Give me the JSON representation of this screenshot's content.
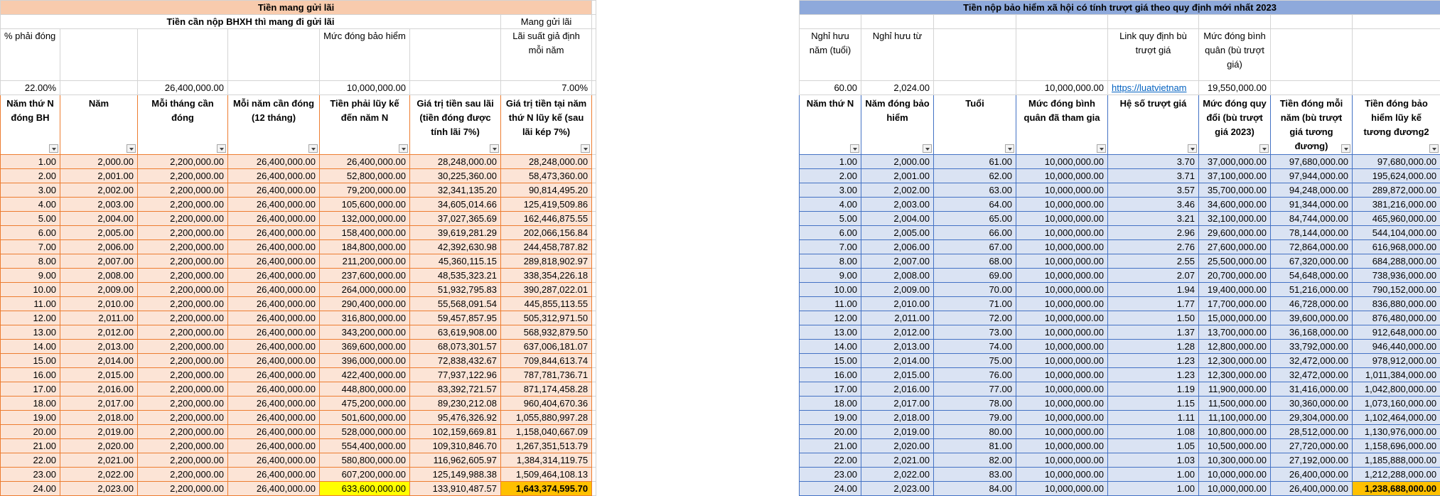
{
  "left": {
    "banner": "Tiền mang gửi lãi",
    "subtitle_left": "Tiền cần nộp BHXH thì mang đi gửi lãi",
    "subtitle_right": "Mang gửi lãi",
    "params_labels": {
      "a": "% phải đóng",
      "b": "",
      "c": "",
      "d": "",
      "e": "Mức đóng bảo hiểm",
      "f": "",
      "g": "Lãi suất giả định mỗi năm"
    },
    "params_values": {
      "a": "22.00%",
      "b": "",
      "c": "26,400,000.00",
      "d": "",
      "e": "10,000,000.00",
      "f": "",
      "g": "7.00%"
    },
    "headers": [
      "Năm thứ N đóng BH",
      "Năm",
      "Mỗi tháng cần đóng",
      "Mỗi năm cần đóng (12 tháng)",
      "Tiền phải lũy kế đến năm N",
      "Giá trị tiền sau lãi (tiền đóng được tính lãi 7%)",
      "Giá trị tiền tại năm thứ N lũy kế (sau lãi kép 7%)"
    ],
    "rows": [
      [
        "1.00",
        "2,000.00",
        "2,200,000.00",
        "26,400,000.00",
        "26,400,000.00",
        "28,248,000.00",
        "28,248,000.00"
      ],
      [
        "2.00",
        "2,001.00",
        "2,200,000.00",
        "26,400,000.00",
        "52,800,000.00",
        "30,225,360.00",
        "58,473,360.00"
      ],
      [
        "3.00",
        "2,002.00",
        "2,200,000.00",
        "26,400,000.00",
        "79,200,000.00",
        "32,341,135.20",
        "90,814,495.20"
      ],
      [
        "4.00",
        "2,003.00",
        "2,200,000.00",
        "26,400,000.00",
        "105,600,000.00",
        "34,605,014.66",
        "125,419,509.86"
      ],
      [
        "5.00",
        "2,004.00",
        "2,200,000.00",
        "26,400,000.00",
        "132,000,000.00",
        "37,027,365.69",
        "162,446,875.55"
      ],
      [
        "6.00",
        "2,005.00",
        "2,200,000.00",
        "26,400,000.00",
        "158,400,000.00",
        "39,619,281.29",
        "202,066,156.84"
      ],
      [
        "7.00",
        "2,006.00",
        "2,200,000.00",
        "26,400,000.00",
        "184,800,000.00",
        "42,392,630.98",
        "244,458,787.82"
      ],
      [
        "8.00",
        "2,007.00",
        "2,200,000.00",
        "26,400,000.00",
        "211,200,000.00",
        "45,360,115.15",
        "289,818,902.97"
      ],
      [
        "9.00",
        "2,008.00",
        "2,200,000.00",
        "26,400,000.00",
        "237,600,000.00",
        "48,535,323.21",
        "338,354,226.18"
      ],
      [
        "10.00",
        "2,009.00",
        "2,200,000.00",
        "26,400,000.00",
        "264,000,000.00",
        "51,932,795.83",
        "390,287,022.01"
      ],
      [
        "11.00",
        "2,010.00",
        "2,200,000.00",
        "26,400,000.00",
        "290,400,000.00",
        "55,568,091.54",
        "445,855,113.55"
      ],
      [
        "12.00",
        "2,011.00",
        "2,200,000.00",
        "26,400,000.00",
        "316,800,000.00",
        "59,457,857.95",
        "505,312,971.50"
      ],
      [
        "13.00",
        "2,012.00",
        "2,200,000.00",
        "26,400,000.00",
        "343,200,000.00",
        "63,619,908.00",
        "568,932,879.50"
      ],
      [
        "14.00",
        "2,013.00",
        "2,200,000.00",
        "26,400,000.00",
        "369,600,000.00",
        "68,073,301.57",
        "637,006,181.07"
      ],
      [
        "15.00",
        "2,014.00",
        "2,200,000.00",
        "26,400,000.00",
        "396,000,000.00",
        "72,838,432.67",
        "709,844,613.74"
      ],
      [
        "16.00",
        "2,015.00",
        "2,200,000.00",
        "26,400,000.00",
        "422,400,000.00",
        "77,937,122.96",
        "787,781,736.71"
      ],
      [
        "17.00",
        "2,016.00",
        "2,200,000.00",
        "26,400,000.00",
        "448,800,000.00",
        "83,392,721.57",
        "871,174,458.28"
      ],
      [
        "18.00",
        "2,017.00",
        "2,200,000.00",
        "26,400,000.00",
        "475,200,000.00",
        "89,230,212.08",
        "960,404,670.36"
      ],
      [
        "19.00",
        "2,018.00",
        "2,200,000.00",
        "26,400,000.00",
        "501,600,000.00",
        "95,476,326.92",
        "1,055,880,997.28"
      ],
      [
        "20.00",
        "2,019.00",
        "2,200,000.00",
        "26,400,000.00",
        "528,000,000.00",
        "102,159,669.81",
        "1,158,040,667.09"
      ],
      [
        "21.00",
        "2,020.00",
        "2,200,000.00",
        "26,400,000.00",
        "554,400,000.00",
        "109,310,846.70",
        "1,267,351,513.79"
      ],
      [
        "22.00",
        "2,021.00",
        "2,200,000.00",
        "26,400,000.00",
        "580,800,000.00",
        "116,962,605.97",
        "1,384,314,119.75"
      ],
      [
        "23.00",
        "2,022.00",
        "2,200,000.00",
        "26,400,000.00",
        "607,200,000.00",
        "125,149,988.38",
        "1,509,464,108.13"
      ],
      [
        "24.00",
        "2,023.00",
        "2,200,000.00",
        "26,400,000.00",
        "633,600,000.00",
        "133,910,487.57",
        "1,643,374,595.70"
      ]
    ]
  },
  "right": {
    "banner": "Tiền nộp bảo hiểm xã hội có tính trượt giá theo quy định mới nhất 2023",
    "params_labels": {
      "a": "Nghỉ hưu năm (tuổi)",
      "b": "Nghỉ hưu từ",
      "c": "",
      "d": "",
      "e": "Link quy định bù trượt giá",
      "f": "Mức đóng bình quân (bù trượt giá)",
      "g": "",
      "h": ""
    },
    "params_values": {
      "a": "60.00",
      "b": "2,024.00",
      "c": "",
      "d": "10,000,000.00",
      "e": "https://luatvietnam",
      "f": "19,550,000.00",
      "g": "",
      "h": ""
    },
    "headers": [
      "Năm thứ N",
      "Năm đóng bảo hiểm",
      "Tuổi",
      "Mức đóng bình quân đã tham gia",
      "Hệ số trượt giá",
      "Mức đóng quy đổi (bù trượt giá 2023)",
      "Tiền đóng mỗi năm (bù trượt giá tương đương)",
      "Tiền đóng bảo hiểm lũy kế tương đương2"
    ],
    "rows": [
      [
        "1.00",
        "2,000.00",
        "61.00",
        "10,000,000.00",
        "3.70",
        "37,000,000.00",
        "97,680,000.00",
        "97,680,000.00"
      ],
      [
        "2.00",
        "2,001.00",
        "62.00",
        "10,000,000.00",
        "3.71",
        "37,100,000.00",
        "97,944,000.00",
        "195,624,000.00"
      ],
      [
        "3.00",
        "2,002.00",
        "63.00",
        "10,000,000.00",
        "3.57",
        "35,700,000.00",
        "94,248,000.00",
        "289,872,000.00"
      ],
      [
        "4.00",
        "2,003.00",
        "64.00",
        "10,000,000.00",
        "3.46",
        "34,600,000.00",
        "91,344,000.00",
        "381,216,000.00"
      ],
      [
        "5.00",
        "2,004.00",
        "65.00",
        "10,000,000.00",
        "3.21",
        "32,100,000.00",
        "84,744,000.00",
        "465,960,000.00"
      ],
      [
        "6.00",
        "2,005.00",
        "66.00",
        "10,000,000.00",
        "2.96",
        "29,600,000.00",
        "78,144,000.00",
        "544,104,000.00"
      ],
      [
        "7.00",
        "2,006.00",
        "67.00",
        "10,000,000.00",
        "2.76",
        "27,600,000.00",
        "72,864,000.00",
        "616,968,000.00"
      ],
      [
        "8.00",
        "2,007.00",
        "68.00",
        "10,000,000.00",
        "2.55",
        "25,500,000.00",
        "67,320,000.00",
        "684,288,000.00"
      ],
      [
        "9.00",
        "2,008.00",
        "69.00",
        "10,000,000.00",
        "2.07",
        "20,700,000.00",
        "54,648,000.00",
        "738,936,000.00"
      ],
      [
        "10.00",
        "2,009.00",
        "70.00",
        "10,000,000.00",
        "1.94",
        "19,400,000.00",
        "51,216,000.00",
        "790,152,000.00"
      ],
      [
        "11.00",
        "2,010.00",
        "71.00",
        "10,000,000.00",
        "1.77",
        "17,700,000.00",
        "46,728,000.00",
        "836,880,000.00"
      ],
      [
        "12.00",
        "2,011.00",
        "72.00",
        "10,000,000.00",
        "1.50",
        "15,000,000.00",
        "39,600,000.00",
        "876,480,000.00"
      ],
      [
        "13.00",
        "2,012.00",
        "73.00",
        "10,000,000.00",
        "1.37",
        "13,700,000.00",
        "36,168,000.00",
        "912,648,000.00"
      ],
      [
        "14.00",
        "2,013.00",
        "74.00",
        "10,000,000.00",
        "1.28",
        "12,800,000.00",
        "33,792,000.00",
        "946,440,000.00"
      ],
      [
        "15.00",
        "2,014.00",
        "75.00",
        "10,000,000.00",
        "1.23",
        "12,300,000.00",
        "32,472,000.00",
        "978,912,000.00"
      ],
      [
        "16.00",
        "2,015.00",
        "76.00",
        "10,000,000.00",
        "1.23",
        "12,300,000.00",
        "32,472,000.00",
        "1,011,384,000.00"
      ],
      [
        "17.00",
        "2,016.00",
        "77.00",
        "10,000,000.00",
        "1.19",
        "11,900,000.00",
        "31,416,000.00",
        "1,042,800,000.00"
      ],
      [
        "18.00",
        "2,017.00",
        "78.00",
        "10,000,000.00",
        "1.15",
        "11,500,000.00",
        "30,360,000.00",
        "1,073,160,000.00"
      ],
      [
        "19.00",
        "2,018.00",
        "79.00",
        "10,000,000.00",
        "1.11",
        "11,100,000.00",
        "29,304,000.00",
        "1,102,464,000.00"
      ],
      [
        "20.00",
        "2,019.00",
        "80.00",
        "10,000,000.00",
        "1.08",
        "10,800,000.00",
        "28,512,000.00",
        "1,130,976,000.00"
      ],
      [
        "21.00",
        "2,020.00",
        "81.00",
        "10,000,000.00",
        "1.05",
        "10,500,000.00",
        "27,720,000.00",
        "1,158,696,000.00"
      ],
      [
        "22.00",
        "2,021.00",
        "82.00",
        "10,000,000.00",
        "1.03",
        "10,300,000.00",
        "27,192,000.00",
        "1,185,888,000.00"
      ],
      [
        "23.00",
        "2,022.00",
        "83.00",
        "10,000,000.00",
        "1.00",
        "10,000,000.00",
        "26,400,000.00",
        "1,212,288,000.00"
      ],
      [
        "24.00",
        "2,023.00",
        "84.00",
        "10,000,000.00",
        "1.00",
        "10,000,000.00",
        "26,400,000.00",
        "1,238,688,000.00"
      ]
    ]
  },
  "colors": {
    "banner_left": "#f8cbad",
    "row_left": "#fce4d6",
    "banner_right": "#8ea9db",
    "row_right": "#dae3f3",
    "highlight_yellow": "#ffff00",
    "highlight_gold": "#ffc000",
    "border_left": "#ed7d31",
    "border_right": "#4472c4"
  }
}
